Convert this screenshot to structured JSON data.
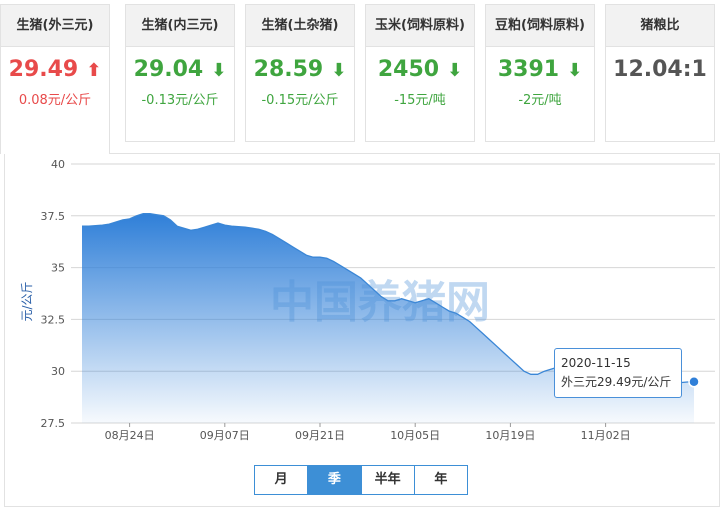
{
  "tabs": [
    {
      "name": "生猪(外三元)",
      "price": "29.49",
      "arrow": "⬆",
      "change": "0.08元/公斤",
      "trend": "up",
      "active": true
    },
    {
      "name": "生猪(内三元)",
      "price": "29.04",
      "arrow": "⬇",
      "change": "-0.13元/公斤",
      "trend": "down",
      "active": false
    },
    {
      "name": "生猪(土杂猪)",
      "price": "28.59",
      "arrow": "⬇",
      "change": "-0.15元/公斤",
      "trend": "down",
      "active": false
    },
    {
      "name": "玉米(饲料原料)",
      "price": "2450",
      "arrow": "⬇",
      "change": "-15元/吨",
      "trend": "down",
      "active": false
    },
    {
      "name": "豆粕(饲料原料)",
      "price": "3391",
      "arrow": "⬇",
      "change": "-2元/吨",
      "trend": "down",
      "active": false
    },
    {
      "name": "猪粮比",
      "price": "12.04:1",
      "arrow": "",
      "change": "",
      "trend": "neutral",
      "active": false
    }
  ],
  "colors": {
    "up": "#e84a4a",
    "down": "#3fa53f",
    "accent": "#3d8fd6",
    "line": "#3a86d6"
  },
  "watermark": "中国养猪网",
  "range_buttons": [
    {
      "label": "月",
      "active": false
    },
    {
      "label": "季",
      "active": true
    },
    {
      "label": "半年",
      "active": false
    },
    {
      "label": "年",
      "active": false
    }
  ],
  "tooltip": {
    "date": "2020-11-15",
    "text": "外三元29.49元/公斤"
  },
  "chart_data": {
    "type": "area",
    "ylabel": "元/公斤",
    "ylim": [
      27.5,
      40
    ],
    "yticks": [
      "40",
      "37.5",
      "35",
      "32.5",
      "30",
      "27.5"
    ],
    "xticks": [
      "08月24日",
      "09月07日",
      "09月21日",
      "10月05日",
      "10月19日",
      "11月02日"
    ],
    "x_start": "2020-08-17",
    "x_end": "2020-11-15",
    "series": [
      {
        "values": [
          37.0,
          37.0,
          37.02,
          37.05,
          37.1,
          37.2,
          37.3,
          37.35,
          37.5,
          37.6,
          37.6,
          37.55,
          37.5,
          37.3,
          37.0,
          36.9,
          36.8,
          36.85,
          36.95,
          37.05,
          37.15,
          37.05,
          37.0,
          36.98,
          36.95,
          36.9,
          36.85,
          36.75,
          36.6,
          36.4,
          36.2,
          36.0,
          35.8,
          35.6,
          35.5,
          35.5,
          35.45,
          35.3,
          35.1,
          34.9,
          34.7,
          34.5,
          34.2,
          33.9,
          33.6,
          33.4,
          33.4,
          33.5,
          33.4,
          33.3,
          33.4,
          33.5,
          33.3,
          33.1,
          32.9,
          32.8,
          32.6,
          32.4,
          32.1,
          31.8,
          31.5,
          31.2,
          30.9,
          30.6,
          30.3,
          30.0,
          29.85,
          29.85,
          30.0,
          30.1,
          30.2,
          30.1,
          30.0,
          29.9,
          29.8,
          29.6,
          29.35,
          29.1,
          28.9,
          28.8,
          28.95,
          29.1,
          29.2,
          29.25,
          29.3,
          29.35,
          29.4,
          29.45,
          29.45,
          29.48,
          29.49
        ]
      }
    ]
  }
}
